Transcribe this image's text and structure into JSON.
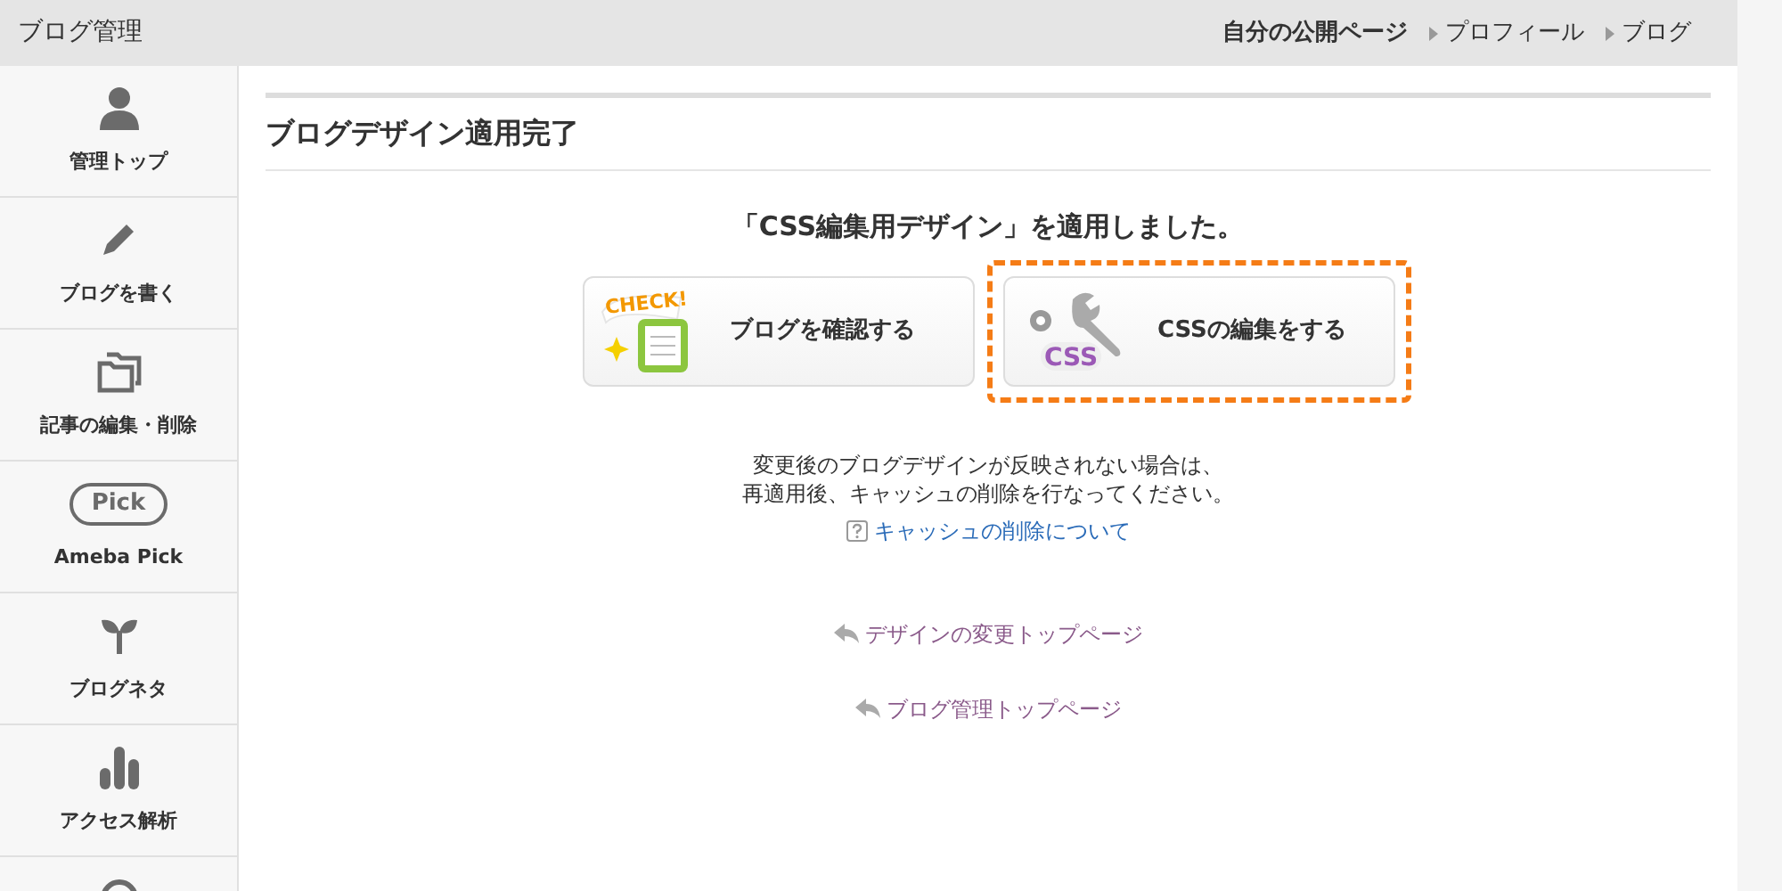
{
  "header": {
    "title": "ブログ管理",
    "links": [
      {
        "label": "自分の公開ページ",
        "kind": "main"
      },
      {
        "label": "プロフィール",
        "kind": "arrow"
      },
      {
        "label": "ブログ",
        "kind": "arrow"
      }
    ]
  },
  "sidebar": {
    "items": [
      {
        "kind": "person",
        "label": "管理トップ"
      },
      {
        "kind": "pencil",
        "label": "ブログを書く"
      },
      {
        "kind": "folder",
        "label": "記事の編集・削除"
      },
      {
        "kind": "pick",
        "icon_text": "Pick",
        "label": "Ameba Pick"
      },
      {
        "kind": "sprout",
        "label": "ブログネタ"
      },
      {
        "kind": "bars",
        "label": "アクセス解析"
      },
      {
        "kind": "circle"
      }
    ]
  },
  "main": {
    "heading": "ブログデザイン適用完了",
    "message": "「CSS編集用デザイン」を適用しました。",
    "buttons": [
      {
        "label": "ブログを確認する",
        "kind": "check",
        "icon_text": "CHECK!",
        "highlighted": false
      },
      {
        "label": "CSSの編集をする",
        "kind": "css",
        "icon_text": "CSS",
        "highlighted": true
      }
    ],
    "note_lines": [
      "変更後のブログデザインが反映されない場合は、",
      "再適用後、キャッシュの削除を行なってください。"
    ],
    "help_link": "キャッシュの削除について",
    "back_links": [
      "デザインの変更トップページ",
      "ブログ管理トップページ"
    ]
  }
}
